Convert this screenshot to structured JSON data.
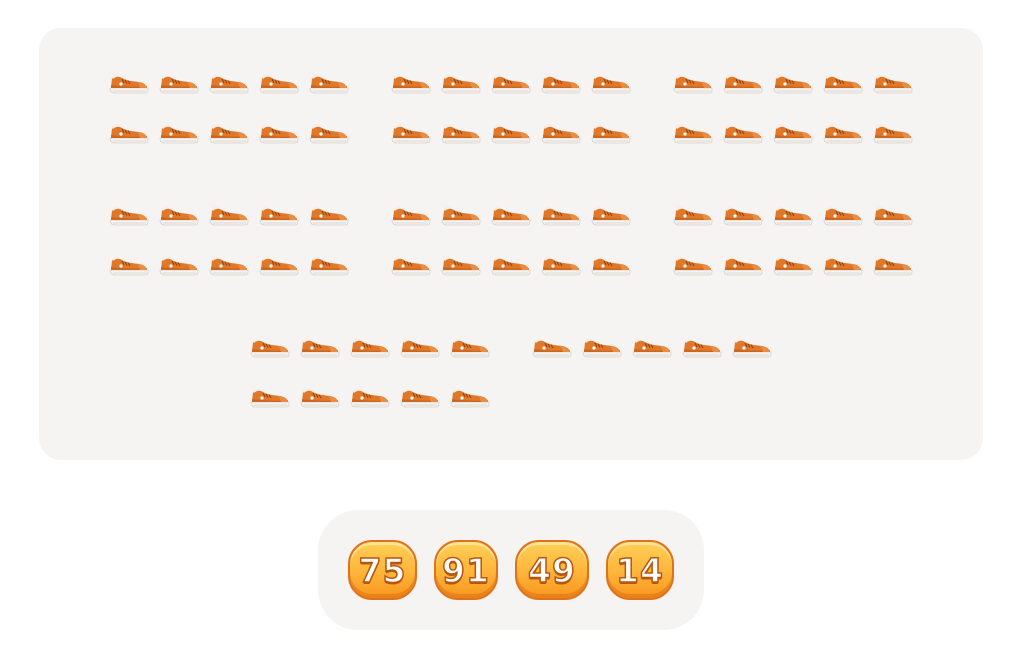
{
  "board": {
    "item": "sneaker-icon",
    "item_color": "#e0782a",
    "groups": [
      {
        "count": 10
      },
      {
        "count": 10
      },
      {
        "count": 10
      },
      {
        "count": 10
      },
      {
        "count": 10
      },
      {
        "count": 10
      },
      {
        "count": 10
      },
      {
        "count": 5
      }
    ]
  },
  "answers": {
    "options": [
      "75",
      "91",
      "49",
      "14"
    ]
  }
}
